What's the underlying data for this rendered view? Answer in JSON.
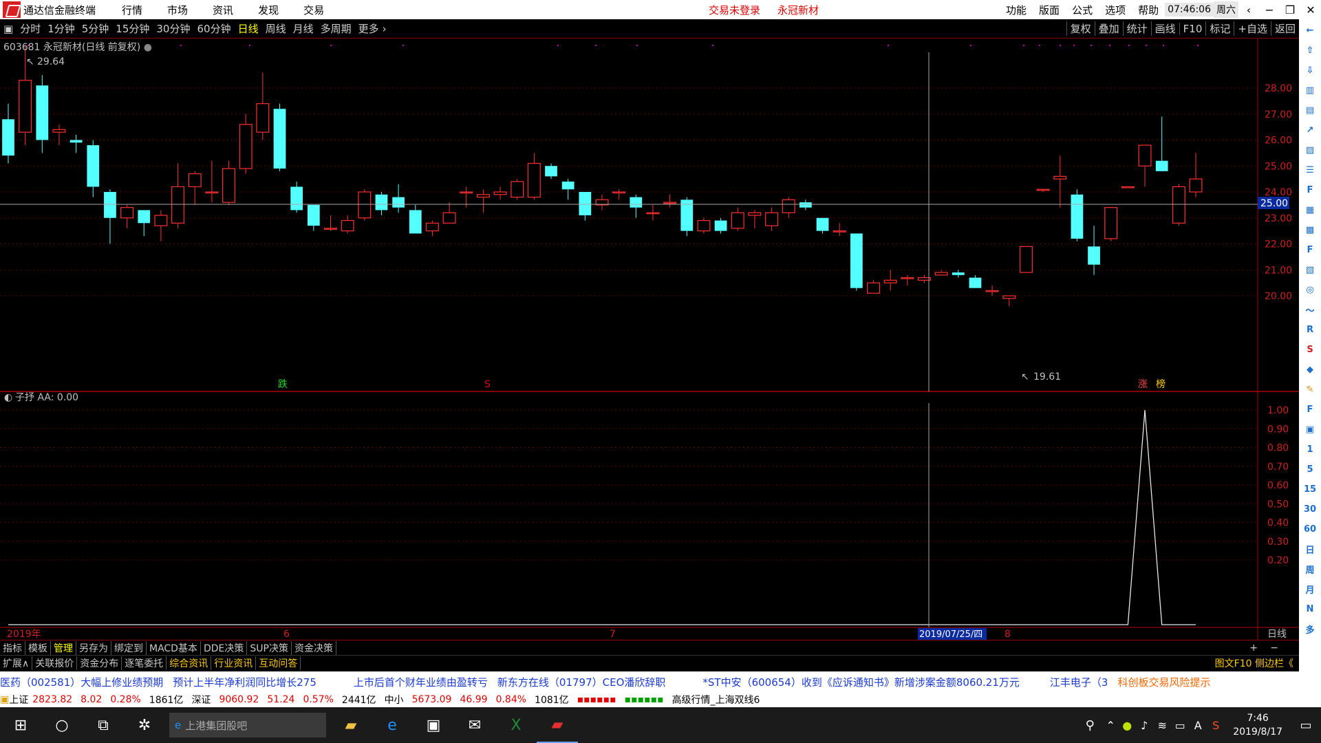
{
  "menubar": {
    "app_title": "通达信金融终端",
    "items": [
      "行情",
      "市场",
      "资讯",
      "发现",
      "交易"
    ],
    "warn1": "交易未登录",
    "warn2": "永冠新材",
    "right_items": [
      "功能",
      "版面",
      "公式",
      "选项",
      "帮助"
    ],
    "clock": "07:46:06",
    "weekday": "周六"
  },
  "toolbar": {
    "periods": [
      "分时",
      "1分钟",
      "5分钟",
      "15分钟",
      "30分钟",
      "60分钟",
      "日线",
      "周线",
      "月线",
      "多周期",
      "更多"
    ],
    "active": "日线",
    "right": [
      "复权",
      "叠加",
      "统计",
      "画线",
      "F10",
      "标记",
      "+自选",
      "返回"
    ]
  },
  "stock": {
    "header": "603681 永冠新材(日线 前复权)",
    "high_label": "29.64",
    "low_label": "19.61",
    "price_marker": "25.00",
    "mark_die": "跌",
    "mark_zhang": "涨",
    "mark_bang": "榜",
    "mark_s": "S"
  },
  "sub": {
    "header": "子抒  AA: 0.00"
  },
  "axis": {
    "main_ticks": [
      "28.00",
      "27.00",
      "26.00",
      "25.00",
      "24.00",
      "23.00",
      "22.00",
      "21.00",
      "20.00"
    ],
    "sub_ticks": [
      "1.00",
      "0.90",
      "0.80",
      "0.70",
      "0.60",
      "0.50",
      "0.40",
      "0.30",
      "0.20"
    ],
    "x_labels": [
      "2019年",
      "6",
      "7",
      "2019/07/25/四",
      "8"
    ],
    "period_label": "日线"
  },
  "sidebar": {
    "icons": [
      "up-arrow-icon",
      "up-arrow-icon",
      "down-arrow-icon",
      "chart-icon",
      "chart-icon",
      "line-icon",
      "chart-icon",
      "list-icon",
      "F10",
      "chart-icon",
      "chart-icon",
      "F2",
      "chart-icon",
      "circle-icon",
      "chart-icon",
      "RSI",
      "S",
      "diamond-icon",
      "pencil-icon",
      "F5",
      "chart-icon",
      "1",
      "5",
      "15",
      "30",
      "60",
      "日",
      "周",
      "月",
      "N",
      "多"
    ],
    "labels": [
      "1",
      "5",
      "15",
      "30",
      "60",
      "日",
      "周",
      "月",
      "N",
      "多"
    ]
  },
  "bottomtabs": [
    "指标",
    "模板",
    "管理",
    "另存为",
    "绑定到",
    "MACD基本",
    "DDE决策",
    "SUP决策",
    "资金决策"
  ],
  "bottomtabs_active": "管理",
  "infotabs": [
    "扩展∧",
    "关联报价",
    "资金分布",
    "逐笔委托",
    "综合资讯",
    "行业资讯",
    "互动问答"
  ],
  "infotabs_right": "图文F10 侧边栏《",
  "news": [
    "医药（002581）大幅上修业绩预期",
    "预计上半年净利润同比增长275",
    "上市后首个财年业绩由盈转亏",
    "新东方在线（01797）CEO潘欣辞职",
    "*ST中安（600654）收到《应诉通知书》新增涉案金额8060.21万元",
    "江丰电子（3",
    "科创板交易风险提示"
  ],
  "indexbar": {
    "sh_label": "上证",
    "sh_val": "2823.82",
    "sh_chg": "8.02",
    "sh_pct": "0.28%",
    "sh_amt": "1861亿",
    "sz_label": "深证",
    "sz_val": "9060.92",
    "sz_chg": "51.24",
    "sz_pct": "0.57%",
    "sz_amt": "2441亿",
    "zx_label": "中小",
    "zx_val": "5673.09",
    "zx_chg": "46.99",
    "zx_pct": "0.84%",
    "zx_amt": "1081亿",
    "info": "高级行情_上海双线6"
  },
  "taskbar": {
    "search_placeholder": "上港集团股吧",
    "time": "7:46",
    "date": "2019/8/17"
  },
  "chart_data": {
    "type": "candlestick",
    "title": "603681 永冠新材(日线 前复权)",
    "ylim": [
      19.0,
      30.0
    ],
    "candles": [
      [
        26.8,
        25.4,
        27.4,
        25.1
      ],
      [
        26.3,
        28.3,
        29.6,
        25.8
      ],
      [
        28.1,
        26.0,
        28.5,
        25.5
      ],
      [
        26.3,
        26.4,
        26.6,
        25.8
      ],
      [
        26.0,
        25.9,
        26.2,
        25.5
      ],
      [
        25.8,
        24.2,
        26.0,
        23.8
      ],
      [
        24.0,
        23.0,
        24.1,
        22.0
      ],
      [
        23.0,
        23.4,
        23.5,
        22.6
      ],
      [
        23.3,
        22.8,
        23.3,
        22.3
      ],
      [
        22.7,
        23.1,
        23.3,
        22.1
      ],
      [
        22.8,
        24.2,
        25.1,
        22.6
      ],
      [
        24.2,
        24.7,
        24.8,
        23.5
      ],
      [
        24.0,
        24.0,
        25.2,
        23.6
      ],
      [
        23.6,
        24.9,
        25.2,
        23.5
      ],
      [
        24.9,
        26.6,
        27.0,
        24.7
      ],
      [
        26.3,
        27.4,
        28.6,
        26.0
      ],
      [
        27.2,
        24.9,
        27.4,
        24.8
      ],
      [
        24.2,
        23.3,
        24.4,
        23.2
      ],
      [
        23.5,
        22.7,
        23.5,
        22.5
      ],
      [
        22.6,
        22.6,
        23.1,
        22.5
      ],
      [
        22.5,
        22.9,
        23.1,
        22.4
      ],
      [
        23.0,
        24.0,
        24.1,
        22.9
      ],
      [
        23.9,
        23.3,
        24.0,
        23.1
      ],
      [
        23.8,
        23.4,
        24.3,
        23.2
      ],
      [
        23.3,
        22.4,
        23.5,
        22.4
      ],
      [
        22.5,
        22.8,
        22.9,
        22.3
      ],
      [
        22.8,
        23.2,
        23.6,
        22.8
      ],
      [
        24.0,
        24.0,
        24.2,
        23.4
      ],
      [
        23.8,
        23.9,
        24.1,
        23.2
      ],
      [
        23.9,
        24.0,
        24.2,
        23.7
      ],
      [
        23.8,
        24.4,
        24.5,
        23.7
      ],
      [
        23.8,
        25.1,
        25.5,
        23.7
      ],
      [
        25.0,
        24.6,
        25.1,
        24.5
      ],
      [
        24.4,
        24.1,
        24.5,
        23.7
      ],
      [
        24.0,
        23.1,
        24.0,
        22.9
      ],
      [
        23.5,
        23.7,
        23.9,
        23.3
      ],
      [
        24.0,
        24.0,
        24.1,
        23.7
      ],
      [
        23.8,
        23.4,
        23.9,
        23.0
      ],
      [
        23.2,
        23.2,
        23.5,
        22.9
      ],
      [
        23.6,
        23.6,
        23.9,
        23.4
      ],
      [
        23.7,
        22.5,
        23.8,
        22.3
      ],
      [
        22.5,
        22.9,
        23.0,
        22.4
      ],
      [
        22.9,
        22.5,
        23.0,
        22.4
      ],
      [
        22.6,
        23.2,
        23.4,
        22.5
      ],
      [
        23.1,
        23.2,
        23.3,
        22.6
      ],
      [
        22.7,
        23.2,
        23.4,
        22.5
      ],
      [
        23.2,
        23.7,
        23.8,
        23.0
      ],
      [
        23.6,
        23.4,
        23.7,
        23.3
      ],
      [
        23.0,
        22.5,
        23.0,
        22.4
      ],
      [
        22.5,
        22.5,
        22.8,
        22.3
      ],
      [
        22.4,
        20.3,
        22.4,
        20.2
      ],
      [
        20.1,
        20.5,
        20.6,
        20.1
      ],
      [
        20.5,
        20.6,
        21.0,
        20.2
      ],
      [
        20.7,
        20.7,
        20.8,
        20.4
      ],
      [
        20.6,
        20.7,
        20.8,
        20.5
      ],
      [
        20.8,
        20.9,
        21.0,
        20.8
      ],
      [
        20.9,
        20.8,
        21.0,
        20.7
      ],
      [
        20.7,
        20.3,
        20.8,
        20.3
      ],
      [
        20.2,
        20.2,
        20.4,
        20.0
      ],
      [
        19.9,
        20.0,
        20.0,
        19.6
      ],
      [
        20.9,
        21.9,
        21.9,
        20.9
      ],
      [
        24.1,
        24.1,
        24.1,
        24.0
      ],
      [
        24.5,
        24.6,
        25.4,
        23.4
      ],
      [
        23.9,
        22.2,
        24.1,
        22.1
      ],
      [
        21.9,
        21.2,
        22.7,
        20.8
      ],
      [
        22.2,
        23.4,
        23.4,
        22.1
      ],
      [
        24.2,
        24.2,
        24.2,
        24.2
      ],
      [
        25.0,
        25.8,
        25.8,
        24.2
      ],
      [
        25.2,
        24.8,
        26.9,
        24.8
      ],
      [
        22.8,
        24.2,
        24.3,
        22.7
      ],
      [
        24.0,
        24.5,
        25.5,
        23.8
      ]
    ],
    "sub_series": {
      "name": "AA",
      "values": [
        0,
        0,
        0,
        0,
        0,
        0,
        0,
        0,
        0,
        0,
        0,
        0,
        0,
        0,
        0,
        0,
        0,
        0,
        0,
        0,
        0,
        0,
        0,
        0,
        0,
        0,
        0,
        0,
        0,
        0,
        0,
        0,
        0,
        0,
        0,
        0,
        0,
        0,
        0,
        0,
        0,
        0,
        0,
        0,
        0,
        0,
        0,
        0,
        0,
        0,
        0,
        0,
        0,
        0,
        0,
        0,
        0,
        0,
        0,
        0,
        0,
        0,
        0,
        0,
        0,
        0,
        0,
        1,
        0,
        0,
        0
      ]
    },
    "sub_ylim": [
      0,
      1.05
    ]
  }
}
